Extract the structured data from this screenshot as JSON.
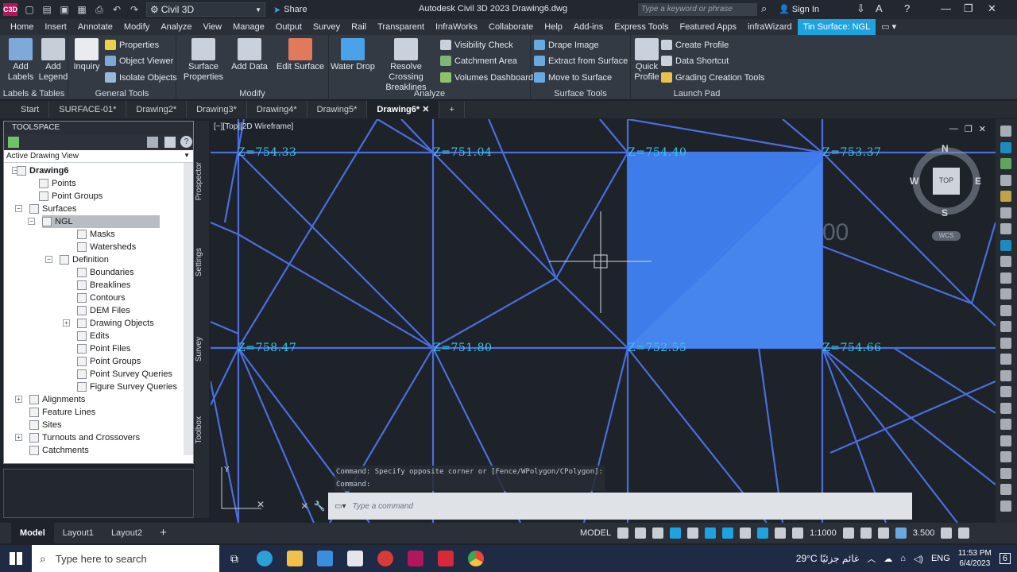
{
  "app": {
    "logo": "C3D",
    "workspace": "Civil 3D",
    "share": "Share",
    "title": "Autodesk Civil 3D 2023    Drawing6.dwg",
    "search_placeholder": "Type a keyword or phrase",
    "sign_in": "Sign In"
  },
  "menu": [
    "Home",
    "Insert",
    "Annotate",
    "Modify",
    "Analyze",
    "View",
    "Manage",
    "Output",
    "Survey",
    "Rail",
    "Transparent",
    "InfraWorks",
    "Collaborate",
    "Help",
    "Add-ins",
    "Express Tools",
    "Featured Apps",
    "infraWizard",
    "Tin Surface: NGL"
  ],
  "ribbon": {
    "panels": {
      "labels_tables": "Labels & Tables",
      "general_tools": "General Tools",
      "modify": "Modify",
      "analyze": "Analyze",
      "surface_tools": "Surface Tools",
      "launch_pad": "Launch Pad"
    },
    "add_labels": "Add Labels",
    "add_legend": "Add Legend",
    "inquiry": "Inquiry",
    "properties": "Properties",
    "object_viewer": "Object Viewer",
    "isolate_objects": "Isolate Objects",
    "surface_properties": "Surface Properties",
    "add_data": "Add Data",
    "edit_surface": "Edit Surface",
    "water_drop": "Water Drop",
    "resolve_crossing": "Resolve Crossing Breaklines",
    "visibility_check": "Visibility Check",
    "catchment_area": "Catchment Area",
    "volumes_dashboard": "Volumes Dashboard",
    "drape_image": "Drape Image",
    "extract_from_surface": "Extract from Surface",
    "move_to_surface": "Move to Surface",
    "quick_profile": "Quick Profile",
    "create_profile": "Create Profile",
    "data_shortcut": "Data Shortcut",
    "grading_creation_tools": "Grading Creation Tools"
  },
  "doc_tabs": [
    "Start",
    "SURFACE-01*",
    "Drawing2*",
    "Drawing3*",
    "Drawing4*",
    "Drawing5*",
    "Drawing6*"
  ],
  "toolspace": {
    "title": "TOOLSPACE",
    "view": "Active Drawing View",
    "tree": [
      {
        "label": "Drawing6",
        "bold": true
      },
      {
        "label": "Points"
      },
      {
        "label": "Point Groups"
      },
      {
        "label": "Surfaces"
      },
      {
        "label": "NGL",
        "selected": true
      },
      {
        "label": "Masks"
      },
      {
        "label": "Watersheds"
      },
      {
        "label": "Definition"
      },
      {
        "label": "Boundaries"
      },
      {
        "label": "Breaklines"
      },
      {
        "label": "Contours"
      },
      {
        "label": "DEM Files"
      },
      {
        "label": "Drawing Objects"
      },
      {
        "label": "Edits"
      },
      {
        "label": "Point Files"
      },
      {
        "label": "Point Groups"
      },
      {
        "label": "Point Survey Queries"
      },
      {
        "label": "Figure Survey Queries"
      },
      {
        "label": "Alignments"
      },
      {
        "label": "Feature Lines"
      },
      {
        "label": "Sites"
      },
      {
        "label": "Turnouts and Crossovers"
      },
      {
        "label": "Catchments"
      }
    ],
    "side_tabs": [
      "Prospector",
      "Settings",
      "Survey",
      "Toolbox"
    ]
  },
  "viewport": {
    "label": "[−][Top][2D Wireframe]",
    "elevations": [
      "Z=754.33",
      "Z=751.04",
      "Z=754.40",
      "Z=753.37",
      "Z=758.47",
      "Z=751.80",
      "Z=752.55",
      "Z=754.66"
    ],
    "faded_text": "00",
    "compass": {
      "n": "N",
      "s": "S",
      "e": "E",
      "w": "W",
      "top": "TOP",
      "wcs": "WCS"
    },
    "colors": {
      "grid": "#4a6ee0",
      "text": "#36c7e8",
      "selection": "#3f7ff0"
    }
  },
  "command": {
    "history": [
      "Command: Specify opposite corner or [Fence/WPolygon/CPolygon]:",
      "Command:"
    ],
    "placeholder": "Type a command"
  },
  "layout_tabs": [
    "Model",
    "Layout1",
    "Layout2"
  ],
  "status": {
    "model": "MODEL",
    "scale": "1:1000",
    "zoom": "3.500"
  },
  "taskbar": {
    "search": "Type here to search",
    "weather": "29°C  غائم جزئيًا",
    "lang": "ENG",
    "time": "11:53 PM",
    "date": "6/4/2023",
    "notif": "6"
  }
}
